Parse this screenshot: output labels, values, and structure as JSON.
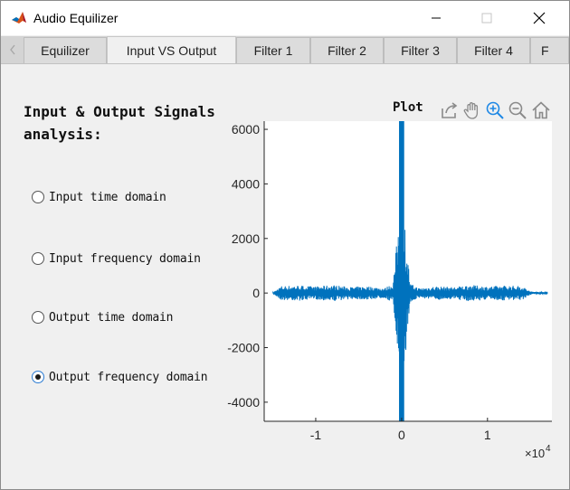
{
  "window": {
    "title": "Audio Equilizer"
  },
  "tabs": [
    {
      "label": "Equilizer",
      "active": false
    },
    {
      "label": "Input VS Output",
      "active": true
    },
    {
      "label": "Filter 1",
      "active": false
    },
    {
      "label": "Filter 2",
      "active": false
    },
    {
      "label": "Filter 3",
      "active": false
    },
    {
      "label": "Filter 4",
      "active": false
    },
    {
      "label": "F",
      "active": false
    }
  ],
  "panel": {
    "heading": "Input & Output Signals analysis:",
    "options": [
      {
        "label": "Input time domain",
        "selected": false
      },
      {
        "label": "Input frequency domain",
        "selected": false
      },
      {
        "label": "Output time domain",
        "selected": false
      },
      {
        "label": "Output frequency domain",
        "selected": true
      }
    ]
  },
  "plot": {
    "title": "Plot",
    "toolbar_icons": [
      "export-icon",
      "pan-hand-icon",
      "zoom-in-icon",
      "zoom-out-icon",
      "home-icon"
    ],
    "exponent_label": "×10",
    "exponent_power": "4"
  },
  "colors": {
    "line": "#0072bd",
    "axis": "#262626",
    "tick_text": "#262626",
    "active_icon": "#1e88e5"
  },
  "chart_data": {
    "type": "line",
    "title": "Plot",
    "xlabel": "",
    "ylabel": "",
    "xlim": [
      -16000,
      17500
    ],
    "ylim": [
      -4700,
      6300
    ],
    "x_ticks": [
      -10000,
      0,
      10000
    ],
    "x_tick_labels": [
      "-1",
      "0",
      "1"
    ],
    "x_exponent": 4,
    "y_ticks": [
      -4000,
      -2000,
      0,
      2000,
      4000,
      6000
    ],
    "y_tick_labels": [
      "-4000",
      "-2000",
      "0",
      "2000",
      "4000",
      "6000"
    ],
    "grid": false,
    "series": [
      {
        "description": "symmetric spectrum: low-level band noise ~±300 from -14000 to 14000, large spike near 0 exceeding axis range",
        "envelope": {
          "x": [
            -15000,
            -14000,
            -12000,
            -10000,
            -8000,
            -6000,
            -4000,
            -2000,
            -1000,
            -300,
            0,
            300,
            1000,
            2000,
            4000,
            6000,
            8000,
            10000,
            12000,
            14000,
            15000,
            17000
          ],
          "amplitude": [
            20,
            260,
            280,
            240,
            300,
            220,
            250,
            180,
            350,
            2800,
            6300,
            2800,
            350,
            180,
            250,
            220,
            300,
            240,
            280,
            260,
            60,
            20
          ]
        }
      }
    ]
  }
}
